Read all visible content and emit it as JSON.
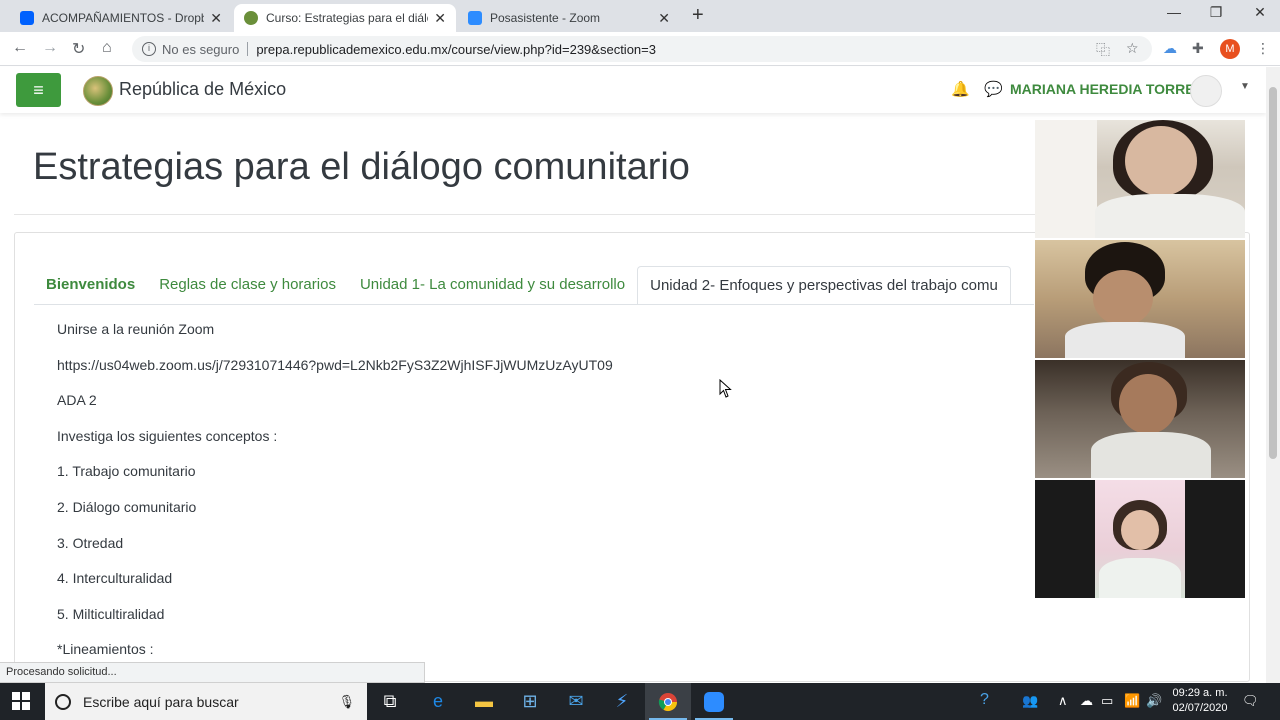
{
  "browser": {
    "tabs": [
      {
        "title": "ACOMPAÑAMIENTOS - Dropbox",
        "favicon_color": "#0061fe"
      },
      {
        "title": "Curso: Estrategias para el diálogo",
        "favicon_color": "#6a8f3a"
      },
      {
        "title": "Posasistente - Zoom",
        "favicon_color": "#2d8cff"
      }
    ],
    "new_tab_label": "+",
    "security_label": "No es seguro",
    "url": "prepa.republicademexico.edu.mx/course/view.php?id=239&section=3",
    "profile_initial": "M"
  },
  "site": {
    "name": "República de México",
    "user_name": "MARIANA HEREDIA TORRES",
    "accent_color": "#3e9a3d"
  },
  "course": {
    "title": "Estrategias para el diálogo comunitario",
    "tabs": [
      {
        "label": "Bienvenidos"
      },
      {
        "label": "Reglas de clase y horarios"
      },
      {
        "label": "Unidad 1- La comunidad y su desarrollo"
      },
      {
        "label": "Unidad 2- Enfoques y perspectivas del trabajo comu"
      }
    ],
    "content": [
      "Unirse a la reunión Zoom",
      "https://us04web.zoom.us/j/72931071446?pwd=L2Nkb2FyS3Z2WjhISFJjWUMzUzAyUT09",
      "ADA 2",
      "Investiga los siguientes conceptos :",
      "1. Trabajo comunitario",
      "2. Diálogo comunitario",
      "3. Otredad",
      "4. Interculturalidad",
      "5. Milticultiralidad",
      "*Lineamientos :"
    ]
  },
  "status_bar": {
    "text": "Procesando solicitud..."
  },
  "taskbar": {
    "search_placeholder": "Escribe aquí para buscar",
    "time": "09:29 a. m.",
    "date": "02/07/2020"
  }
}
